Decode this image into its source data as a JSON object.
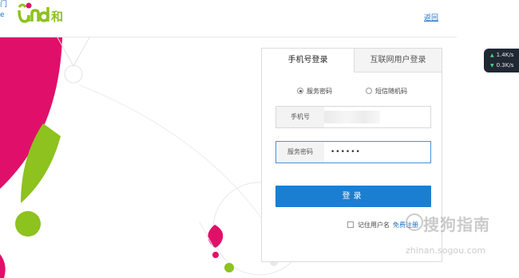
{
  "header": {
    "brand_partial_line1": "门",
    "brand_partial_line2": "e",
    "logo_text": "和",
    "back_label": "返回"
  },
  "login": {
    "tabs": [
      {
        "label": "手机号登录",
        "active": true
      },
      {
        "label": "互联网用户登录",
        "active": false
      }
    ],
    "auth_options": [
      {
        "label": "服务密码",
        "selected": true
      },
      {
        "label": "短信随机码",
        "selected": false
      }
    ],
    "phone_label": "手机号",
    "password_label": "服务密码",
    "password_value": "••••••",
    "submit_label": "登录",
    "remember_label": "记住用户名",
    "register_label": "免费注册"
  },
  "speed_widget": {
    "upload": "1.4K/s",
    "download": "0.3K/s"
  },
  "watermark": {
    "title": "搜狗指南",
    "url": "zhinan.sogou.com"
  },
  "colors": {
    "brand_pink": "#e0106a",
    "brand_green": "#8dc21f",
    "accent_blue": "#1b7fd1"
  }
}
